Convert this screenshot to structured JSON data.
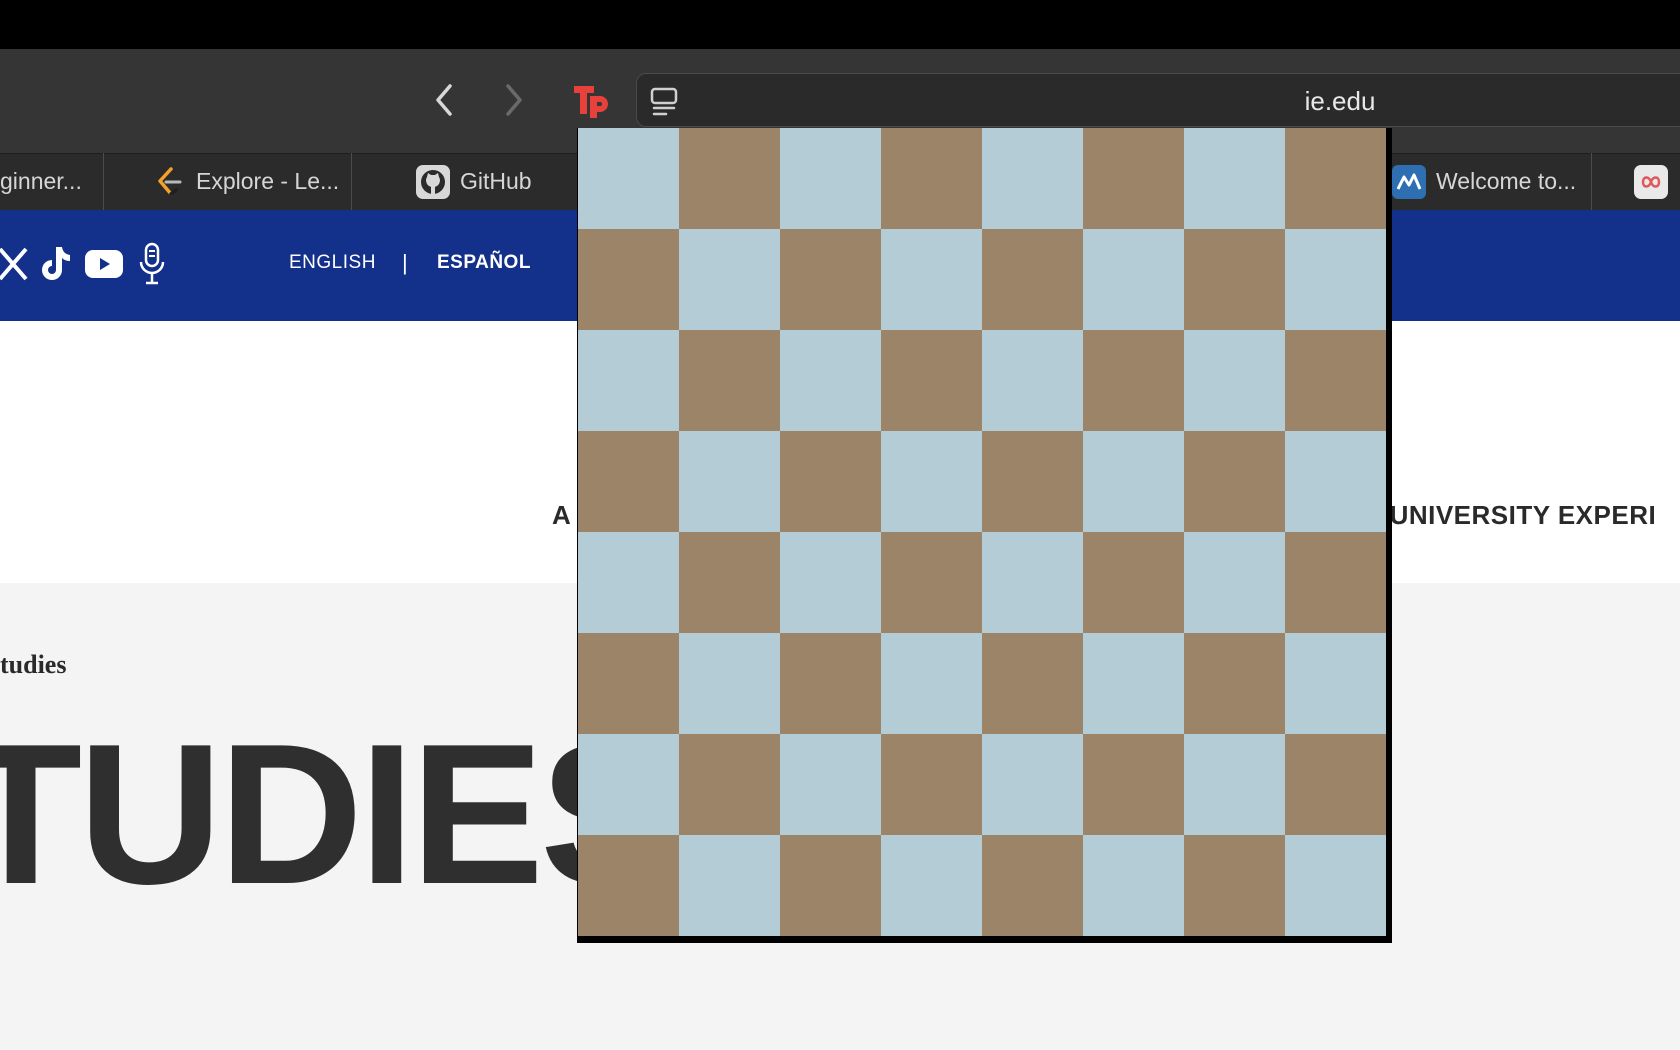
{
  "browser": {
    "url": "ie.edu",
    "tabs": [
      {
        "label": "ginner...",
        "icon": "tab-partial-icon"
      },
      {
        "label": "Explore - Le...",
        "icon": "leetcode-icon"
      },
      {
        "label": "GitHub",
        "icon": "github-icon"
      },
      {
        "label": "Welcome to...",
        "icon": "welcome-site-icon"
      },
      {
        "label": "",
        "icon": "infinity-icon"
      }
    ]
  },
  "site": {
    "lang_english": "ENGLISH",
    "lang_separator": "|",
    "lang_spanish": "ESPAÑOL",
    "tagline_left": "A",
    "tagline_right": "E UNIVERSITY EXPERI",
    "breadcrumb": "tudies",
    "hero_title": "TUDIES"
  },
  "board": {
    "rows": 8,
    "cols": 8,
    "light_color": "#b3ccd5",
    "dark_color": "#9b8468",
    "top_left": "light"
  },
  "colors": {
    "header_blue": "#13308a",
    "toolbar": "#353535",
    "tab_bar": "#2b2b2b"
  }
}
